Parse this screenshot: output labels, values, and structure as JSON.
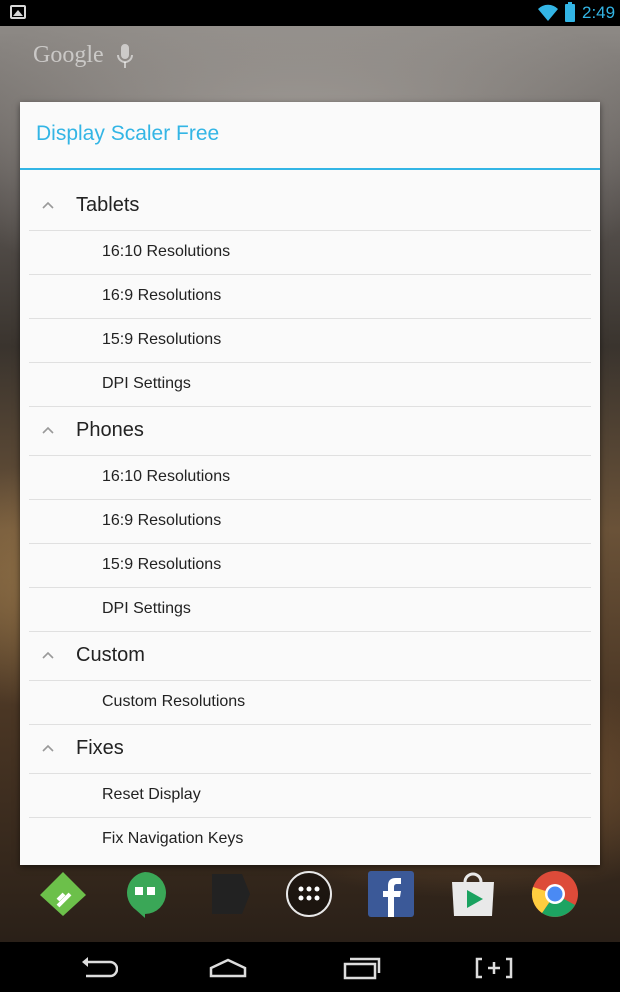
{
  "status_bar": {
    "time": "2:49",
    "icons": [
      "picture-notification-icon",
      "wifi-icon",
      "battery-icon"
    ]
  },
  "home": {
    "search_label": "Google",
    "mic_icon": "mic-icon"
  },
  "dialog": {
    "title": "Display Scaler Free",
    "groups": [
      {
        "label": "Tablets",
        "items": [
          "16:10 Resolutions",
          "16:9 Resolutions",
          "15:9 Resolutions",
          "DPI Settings"
        ]
      },
      {
        "label": "Phones",
        "items": [
          "16:10 Resolutions",
          "16:9 Resolutions",
          "15:9 Resolutions",
          "DPI Settings"
        ]
      },
      {
        "label": "Custom",
        "items": [
          "Custom Resolutions"
        ]
      },
      {
        "label": "Fixes",
        "items": [
          "Reset Display",
          "Fix Navigation Keys"
        ]
      }
    ]
  },
  "dock": {
    "apps": [
      "feedly-icon",
      "hangouts-icon",
      "app-icon",
      "app-drawer-icon",
      "facebook-icon",
      "play-store-icon",
      "chrome-icon"
    ]
  },
  "nav_bar": {
    "buttons": [
      "back-icon",
      "home-icon",
      "recents-icon",
      "screenshot-icon"
    ]
  },
  "colors": {
    "accent": "#33b5e5",
    "dialog_bg": "#fafafa",
    "divider": "#e0e0e0"
  }
}
